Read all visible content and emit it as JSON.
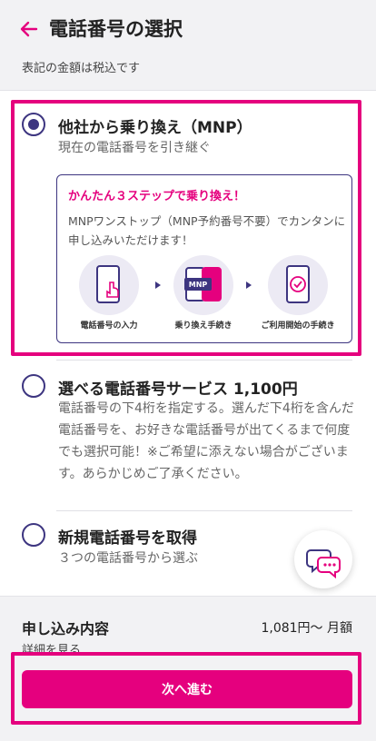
{
  "header": {
    "title": "電話番号の選択",
    "subtitle": "表記の金額は税込です"
  },
  "options": [
    {
      "title": "他社から乗り換え（MNP）",
      "subtitle": "現在の電話番号を引き継ぐ",
      "selected": true,
      "mnp_box": {
        "heading": "かんたん３ステップで乗り換え！",
        "description": "MNPワンストップ（MNP予約番号不要）でカンタンに申し込みいただけます！",
        "steps": [
          {
            "label": "電話番号の入力",
            "icon": "phone-tap-icon"
          },
          {
            "label": "乗り換え手続き",
            "icon": "mnp-transfer-icon",
            "icon_text": "MNP"
          },
          {
            "label": "ご利用開始の手続き",
            "icon": "phone-check-icon"
          }
        ]
      }
    },
    {
      "title_text": "選べる電話番号サービス ",
      "price": "1,100円",
      "description": "電話番号の下4桁を指定する。選んだ下4桁を含んだ電話番号を、お好きな電話番号が出てくるまで何度でも選択可能！※ご希望に添えない場合がございます。あらかじめご了承ください。",
      "selected": false
    },
    {
      "title": "新規電話番号を取得",
      "subtitle": "３つの電話番号から選ぶ",
      "selected": false
    }
  ],
  "summary": {
    "label": "申し込み内容",
    "price": "1,081円〜 月額",
    "details_link": "詳細を見る"
  },
  "next_button": "次へ進む",
  "colors": {
    "accent": "#e5007e",
    "primary": "#3d3580"
  }
}
